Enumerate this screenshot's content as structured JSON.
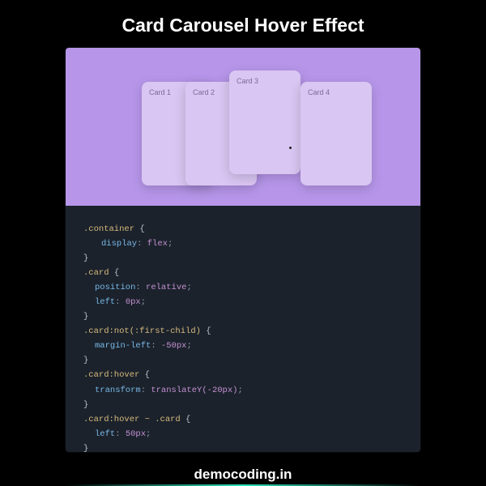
{
  "title": "Card Carousel Hover Effect",
  "cards": {
    "c1": "Card 1",
    "c2": "Card 2",
    "c3": "Card 3",
    "c4": "Card 4"
  },
  "code": {
    "l1_sel": ".container",
    "l1_b": " {",
    "l2_prop": "display",
    "l2_colon": ": ",
    "l2_val": "flex",
    "l2_semi": ";",
    "l3_b": "}",
    "l4_sel": ".card",
    "l4_b": " {",
    "l5_prop": "position",
    "l5_colon": ": ",
    "l5_val": "relative",
    "l5_semi": ";",
    "l6_prop": "left",
    "l6_colon": ": ",
    "l6_val": "0px",
    "l6_semi": ";",
    "l7_b": "}",
    "l8_sel": ".card:not(:first-child)",
    "l8_b": " {",
    "l9_prop": "margin-left",
    "l9_colon": ": ",
    "l9_val": "-50px",
    "l9_semi": ";",
    "l10_b": "}",
    "l11_sel": ".card:hover",
    "l11_b": " {",
    "l12_prop": "transform",
    "l12_colon": ": ",
    "l12_val": "translateY(-20px)",
    "l12_semi": ";",
    "l13_b": "}",
    "l14_sel": ".card:hover ~ .card",
    "l14_b": " {",
    "l15_prop": "left",
    "l15_colon": ": ",
    "l15_val": "50px",
    "l15_semi": ";",
    "l16_b": "}"
  },
  "footer": "democoding.in"
}
